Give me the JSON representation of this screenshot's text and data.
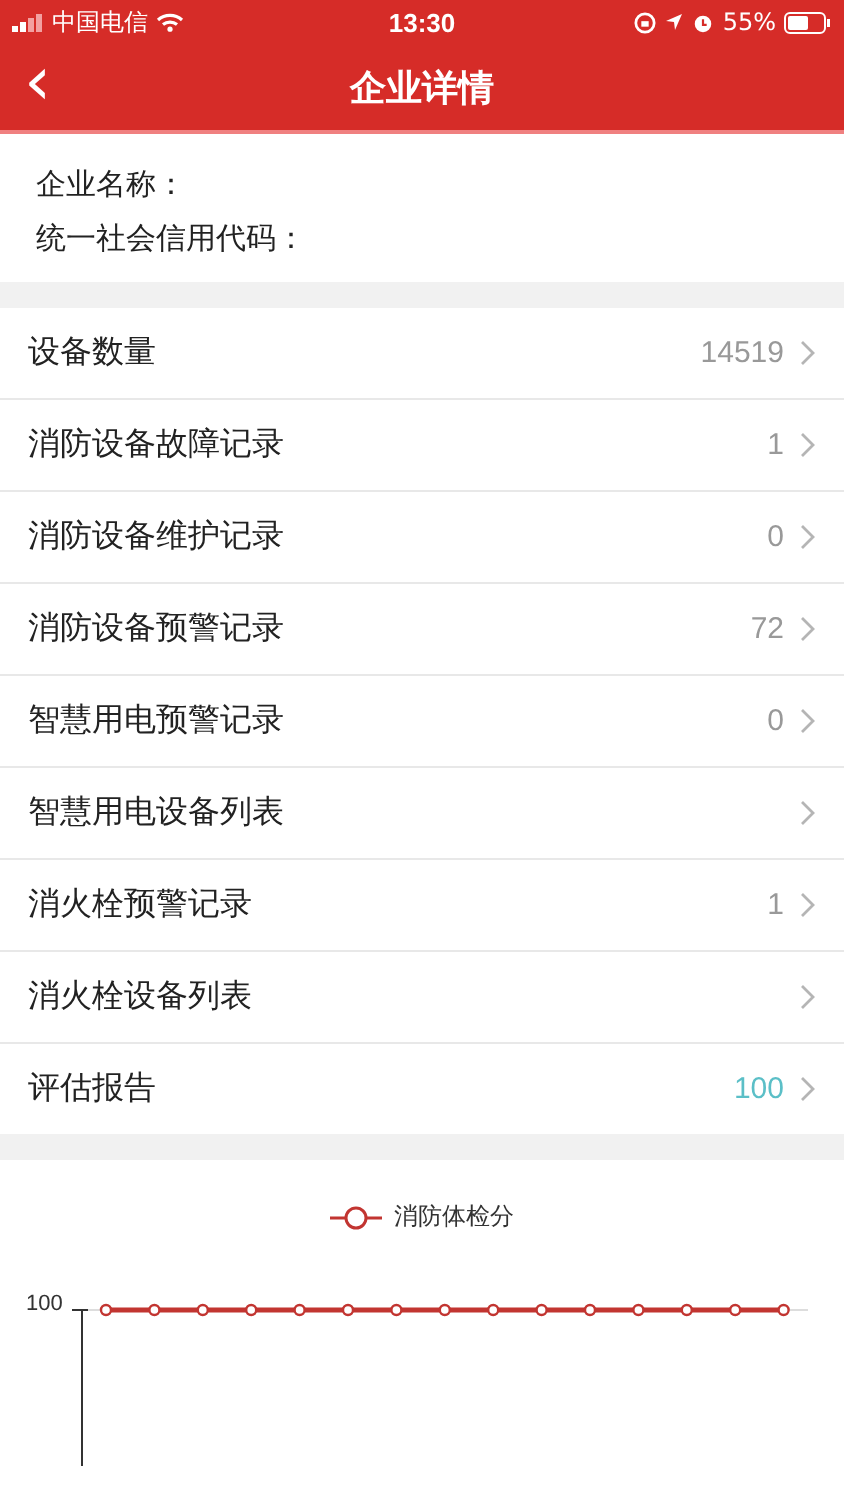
{
  "status_bar": {
    "carrier": "中国电信",
    "time": "13:30",
    "battery": "55%"
  },
  "nav": {
    "back": "‹",
    "title": "企业详情"
  },
  "info": [
    "企业名称：",
    "统一社会信用代码："
  ],
  "rows": [
    {
      "label": "设备数量",
      "value": "14519",
      "color": "#999999"
    },
    {
      "label": "消防设备故障记录",
      "value": "1",
      "color": "#999999"
    },
    {
      "label": "消防设备维护记录",
      "value": "0",
      "color": "#999999"
    },
    {
      "label": "消防设备预警记录",
      "value": "72",
      "color": "#999999"
    },
    {
      "label": "智慧用电预警记录",
      "value": "0",
      "color": "#999999"
    },
    {
      "label": "智慧用电设备列表"
    },
    {
      "label": "消火栓预警记录",
      "value": "1",
      "color": "#999999"
    },
    {
      "label": "消火栓设备列表"
    },
    {
      "label": "评估报告",
      "value": "100",
      "color": "#5bbfc7"
    }
  ],
  "chart": {
    "legend": "消防体检分",
    "y_tick": "100"
  }
}
